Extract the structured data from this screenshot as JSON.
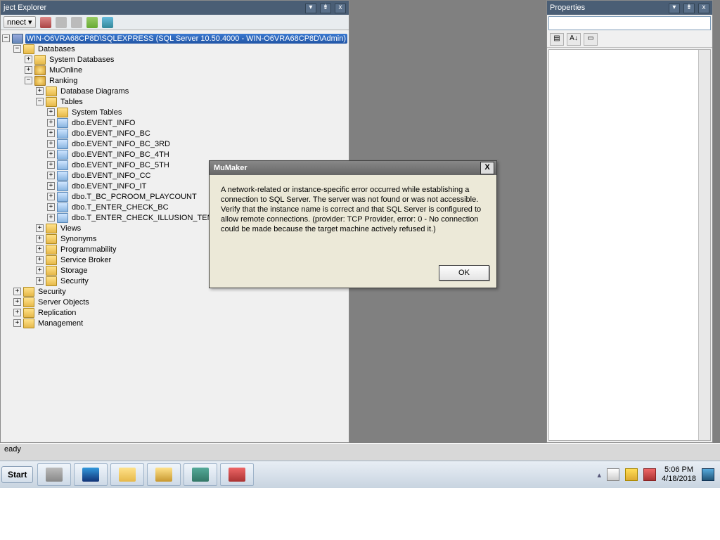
{
  "explorer": {
    "title": "ject Explorer",
    "connect_label": "nnect ▾",
    "root": "WIN-O6VRA68CP8D\\SQLEXPRESS (SQL Server 10.50.4000 - WIN-O6VRA68CP8D\\Admin)",
    "databases": "Databases",
    "system_db": "System Databases",
    "muonline": "MuOnline",
    "ranking": "Ranking",
    "db_diagrams": "Database Diagrams",
    "tables": "Tables",
    "system_tables": "System Tables",
    "table_list": [
      "dbo.EVENT_INFO",
      "dbo.EVENT_INFO_BC",
      "dbo.EVENT_INFO_BC_3RD",
      "dbo.EVENT_INFO_BC_4TH",
      "dbo.EVENT_INFO_BC_5TH",
      "dbo.EVENT_INFO_CC",
      "dbo.EVENT_INFO_IT",
      "dbo.T_BC_PCROOM_PLAYCOUNT",
      "dbo.T_ENTER_CHECK_BC",
      "dbo.T_ENTER_CHECK_ILLUSION_TEMP"
    ],
    "ranking_rest": [
      "Views",
      "Synonyms",
      "Programmability",
      "Service Broker",
      "Storage",
      "Security"
    ],
    "top_rest": [
      "Security",
      "Server Objects",
      "Replication",
      "Management"
    ]
  },
  "properties": {
    "title": "Properties"
  },
  "status": {
    "text": "eady"
  },
  "taskbar": {
    "start": "Start",
    "time": "5:06 PM",
    "date": "4/18/2018"
  },
  "dialog": {
    "title": "MuMaker",
    "message": "A network-related or instance-specific error occurred while establishing a connection to SQL Server. The server was not found or was not accessible. Verify that the instance name is correct and that SQL Server is configured to allow remote connections. (provider: TCP Provider, error: 0 - No connection could be made because the target machine actively refused it.)",
    "ok": "OK"
  }
}
